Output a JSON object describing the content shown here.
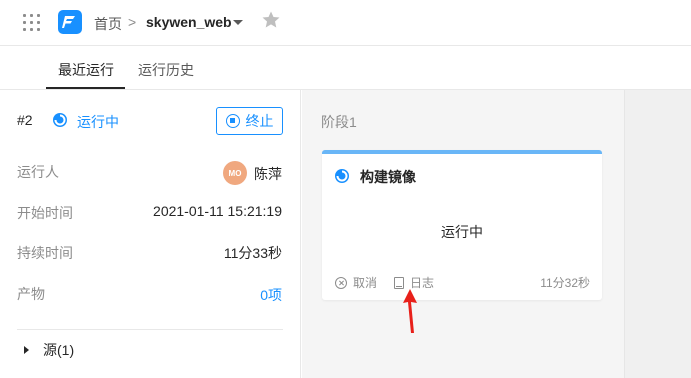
{
  "header": {
    "breadcrumb_home": "首页",
    "breadcrumb_separator": ">",
    "project_name": "skywen_web",
    "icons": [
      "apps-grid-icon",
      "app-logo-icon",
      "chevron-down-icon",
      "star-icon"
    ]
  },
  "tabs": [
    {
      "label": "最近运行",
      "active": true
    },
    {
      "label": "运行历史",
      "active": false
    }
  ],
  "run": {
    "number": "#2",
    "status": "运行中",
    "stop_label": "终止",
    "fields": [
      {
        "label": "运行人",
        "value": "陈萍",
        "avatar_text": "MO"
      },
      {
        "label": "开始时间",
        "value": "2021-01-11 15:21:19"
      },
      {
        "label": "持续时间",
        "value": "11分33秒"
      },
      {
        "label": "产物",
        "value": "0项"
      }
    ],
    "source_label": "源(1)"
  },
  "stage": {
    "label": "阶段1",
    "job": {
      "title": "构建镜像",
      "status": "运行中",
      "cancel_label": "取消",
      "log_label": "日志",
      "duration": "11分32秒"
    }
  },
  "colors": {
    "accent": "#1890ff",
    "card_top": "#69b6f7",
    "avatar": "#f0a87f",
    "arrow": "#e8201a"
  }
}
